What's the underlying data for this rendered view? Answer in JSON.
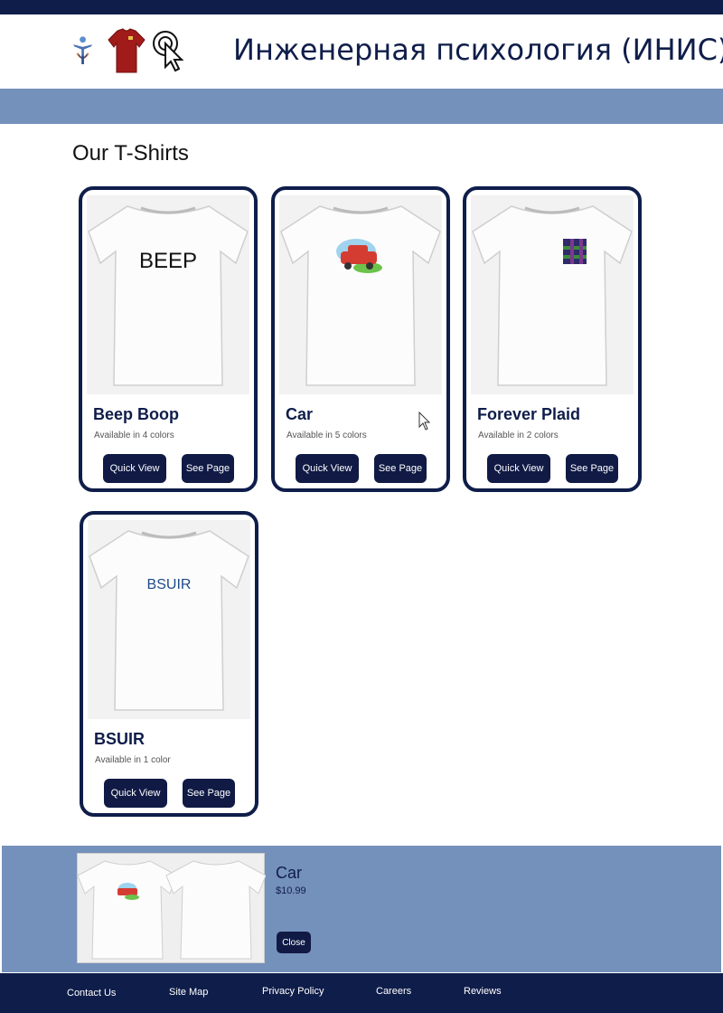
{
  "header": {
    "title": "Инженерная психология (ИНИС)",
    "logos": [
      "person-logo-icon",
      "red-tshirt-logo-icon",
      "cursor-click-logo-icon"
    ]
  },
  "section_title": "Our T-Shirts",
  "products": [
    {
      "name": "Beep Boop",
      "availability": "Available in 4 colors",
      "print_text": "BEEP",
      "quick_view": "Quick View",
      "see_page": "See Page"
    },
    {
      "name": "Car",
      "availability": "Available in 5 colors",
      "quick_view": "Quick View",
      "see_page": "See Page"
    },
    {
      "name": "Forever Plaid",
      "availability": "Available in 2 colors",
      "quick_view": "Quick View",
      "see_page": "See Page"
    },
    {
      "name": "BSUIR",
      "availability": "Available in 1 color",
      "print_text": "BSUIR",
      "quick_view": "Quick View",
      "see_page": "See Page"
    }
  ],
  "preview": {
    "name": "Car",
    "price": "$10.99",
    "close_label": "Close"
  },
  "footer": {
    "links": [
      "Contact Us",
      "Site Map",
      "Privacy Policy",
      "Careers",
      "Reviews"
    ]
  },
  "colors": {
    "navy": "#0f1d4a",
    "band": "#7491bb",
    "button": "#101a45"
  }
}
